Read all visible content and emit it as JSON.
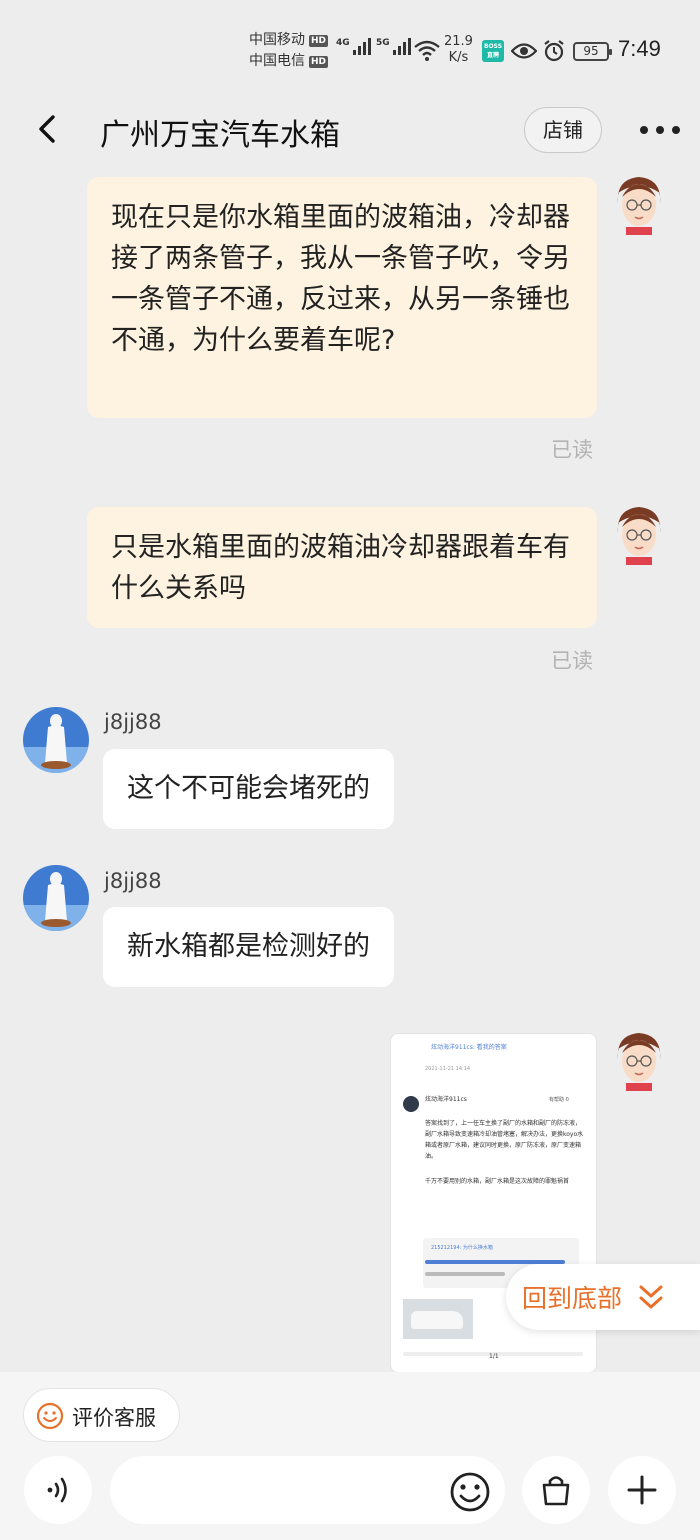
{
  "status_bar": {
    "carrier1": "中国移动",
    "carrier2": "中国电信",
    "hd_badge": "HD",
    "net1": "4G",
    "net2": "5G",
    "speed_value": "21.9",
    "speed_unit": "K/s",
    "boss_badge_top": "BOSS",
    "boss_badge_bottom": "直聘",
    "battery": "95",
    "time": "7:49"
  },
  "header": {
    "title": "广州万宝汽车水箱",
    "shop_label": "店铺"
  },
  "messages": [
    {
      "from": "me",
      "text": "现在只是你水箱里面的波箱油，冷却器接了两条管子，我从一条管子吹，令另一条管子不通，反过来，从另一条锤也不通，为什么要着车呢?",
      "status": "已读"
    },
    {
      "from": "me",
      "text": "只是水箱里面的波箱油冷却器跟着车有什么关系吗",
      "status": "已读"
    },
    {
      "from": "peer",
      "nickname": "j8jj88",
      "text": "这个不可能会堵死的"
    },
    {
      "from": "peer",
      "nickname": "j8jj88",
      "text": "新水箱都是检测好的"
    },
    {
      "from": "me",
      "type": "image",
      "thumbnail_texts": {
        "top_line": "炫动海洋911cs: 看我的答案",
        "date1": "2021-11-21 14:14",
        "username": "炫动海洋911cs",
        "helpful": "有帮助 0",
        "answer": "答案找到了，上一任车主换了副厂的水箱和副厂的防冻液，副厂水箱导致变速箱冷却油管堵塞，解决办法，更换koyo水箱或者原厂水箱，建议同时更换，原厂防冻液，原厂变速箱油。",
        "warning": "千万不要用别的水箱，副厂水箱是这次故障的罪魁祸首",
        "quote_user": "2152121​94: 为什么换水箱",
        "page": "1/1"
      }
    }
  ],
  "scroll_to_bottom_label": "回到底部",
  "bottom": {
    "rate_service_label": "评价客服",
    "input_placeholder": ""
  },
  "colors": {
    "outgoing_bubble": "#fdf3e0",
    "accent_orange": "#e8702a",
    "background": "#ededed"
  }
}
